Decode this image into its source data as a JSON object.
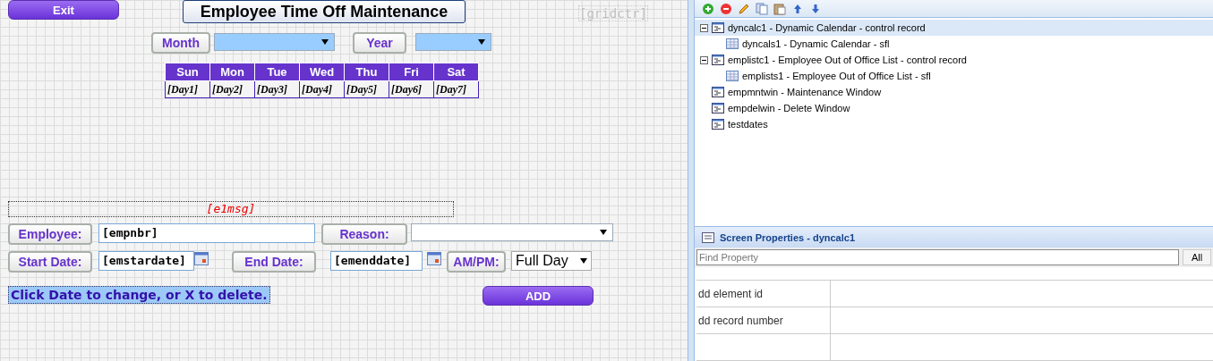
{
  "canvas": {
    "exit_button": "Exit",
    "title": "Employee Time Off Maintenance",
    "grid_counter": "[gridctr]",
    "month_label": "Month",
    "year_label": "Year",
    "calendar": {
      "headers": [
        "Sun",
        "Mon",
        "Tue",
        "Wed",
        "Thu",
        "Fri",
        "Sat"
      ],
      "cells": [
        "[Day1]",
        "[Day2]",
        "[Day3]",
        "[Day4]",
        "[Day5]",
        "[Day6]",
        "[Day7]"
      ]
    },
    "error_message": "[e1msg]",
    "employee_label": "Employee:",
    "employee_value": "[empnbr]",
    "reason_label": "Reason:",
    "start_label": "Start Date:",
    "start_value": "[emstardate]",
    "end_label": "End Date:",
    "end_value": "[emenddate]",
    "ampm_label": "AM/PM:",
    "ampm_value": "Full Day",
    "hint": "Click Date to change, or X to delete.",
    "add_button": "ADD"
  },
  "tree": [
    {
      "label": "dyncalc1 - Dynamic Calendar - control record",
      "selected": true,
      "expanded": true,
      "children": [
        {
          "label": "dyncals1 - Dynamic Calendar - sfl",
          "selected": false
        }
      ]
    },
    {
      "label": "emplistc1 - Employee Out of Office List - control record",
      "selected": false,
      "expanded": true,
      "children": [
        {
          "label": "emplists1 - Employee Out of Office List - sfl",
          "selected": false
        }
      ]
    },
    {
      "label": "empmntwin - Maintenance Window",
      "selected": false
    },
    {
      "label": "empdelwin - Delete Window",
      "selected": false
    },
    {
      "label": "testdates",
      "selected": false
    }
  ],
  "properties": {
    "title": "Screen Properties - dyncalc1",
    "search_placeholder": "Find Property",
    "all_button": "All",
    "rows": [
      {
        "name": "dd element id"
      },
      {
        "name": "dd record number"
      },
      {
        "name": ""
      }
    ]
  }
}
